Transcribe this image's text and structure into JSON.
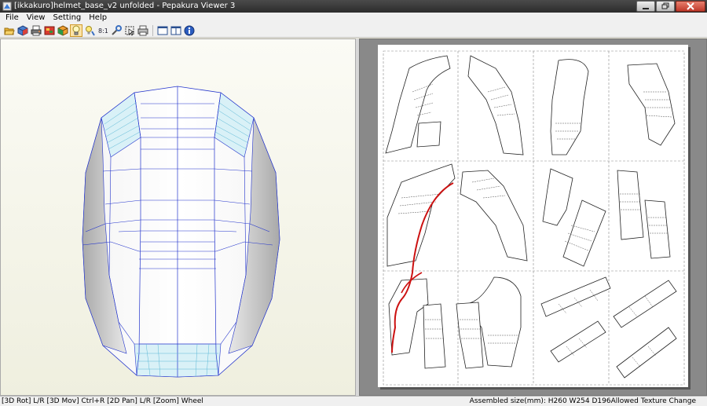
{
  "window": {
    "title": "[ikkakuro]helmet_base_v2 unfolded - Pepakura Viewer 3",
    "buttons": [
      "minimize",
      "maximize",
      "close"
    ]
  },
  "menu": {
    "items": [
      {
        "label": "File"
      },
      {
        "label": "View"
      },
      {
        "label": "Setting"
      },
      {
        "label": "Help"
      }
    ]
  },
  "toolbar": {
    "icons": [
      "open-icon",
      "3d-cube-icon",
      "print-icon",
      "texture-icon",
      "box-icon",
      "light-bulb-icon",
      "lightbulb-settings-icon",
      "numbered-edges-icon",
      "tool-icon",
      "select-icon",
      "printer-icon",
      "window-single-icon",
      "window-split-icon",
      "info-icon"
    ],
    "active_icon": "light-bulb-icon"
  },
  "status": {
    "left": "[3D Rot] L/R [3D Mov] Ctrl+R [2D Pan] L/R [Zoom] Wheel",
    "right": "Assembled size(mm): H260 W254 D196Allowed Texture Change"
  },
  "colors": {
    "title_bar": "#2c2c2c",
    "model_edge": "#2233cc",
    "highlight_edge": "#cc1111",
    "paper_bg": "#898989"
  }
}
